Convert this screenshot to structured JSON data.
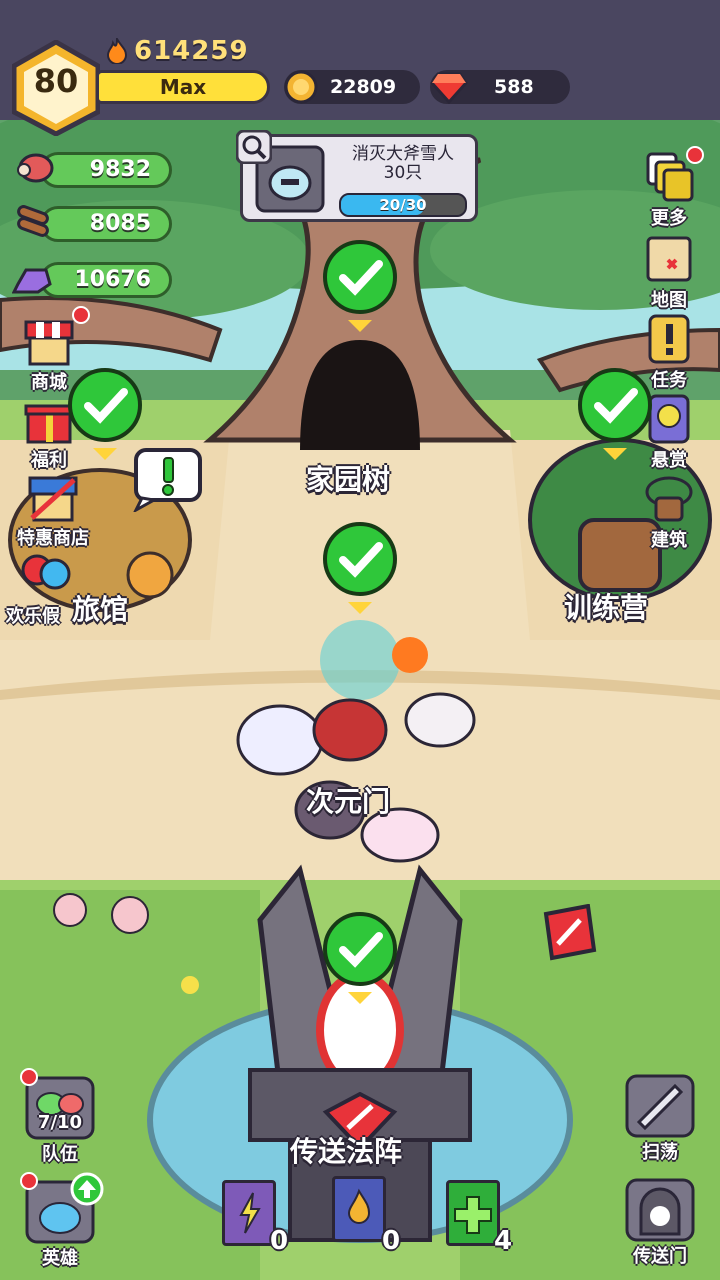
{
  "player": {
    "level": "80",
    "power": "614259",
    "xp_label": "Max"
  },
  "currencies": {
    "gold": "22809",
    "gems": "588"
  },
  "resources": {
    "meat": "9832",
    "wood": "8085",
    "crystal": "10676"
  },
  "quest": {
    "title_line1": "消灭大斧雪人",
    "title_line2": "30只",
    "progress_text": "20/30",
    "progress": 0.667
  },
  "left_menu": {
    "shop": "商城",
    "welfare": "福利",
    "special_shop": "特惠商店",
    "holiday": "欢乐假"
  },
  "right_menu": {
    "more": "更多",
    "map": "地图",
    "tasks": "任务",
    "bounty": "悬赏",
    "build": "建筑"
  },
  "places": {
    "home_tree": "家园树",
    "inn": "旅馆",
    "training": "训练营",
    "dimension_gate": "次元门",
    "teleport_array": "传送法阵"
  },
  "bottom_left": {
    "team_count": "7/10",
    "team": "队伍",
    "heroes": "英雄"
  },
  "bottom_right": {
    "sweep": "扫荡",
    "portal": "传送门"
  },
  "books": {
    "purple_count": "0",
    "blue_count": "0",
    "green_count": "4"
  },
  "colors": {
    "check_green": "#2fc73a",
    "gold": "#ffd43a",
    "topbar": "#4a4660",
    "resource_green": "#64c95a"
  }
}
